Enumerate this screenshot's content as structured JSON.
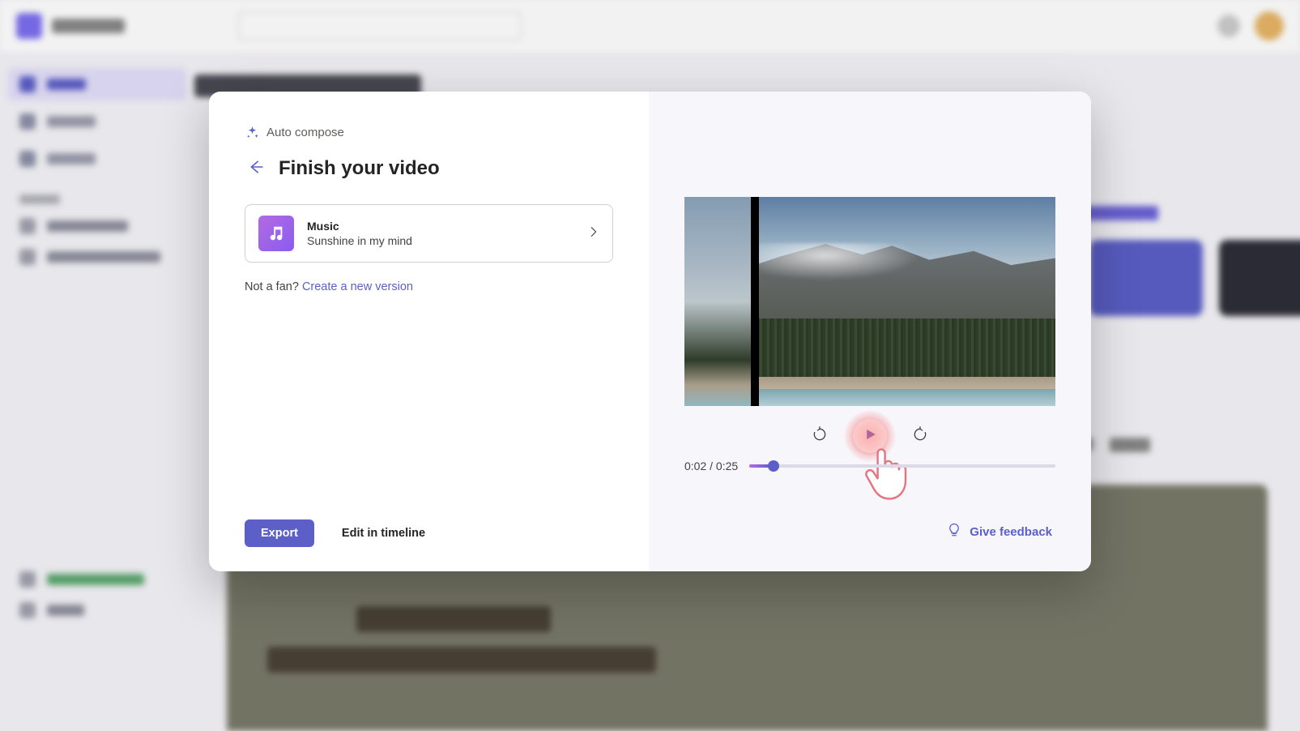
{
  "dialog": {
    "auto_compose_label": "Auto compose",
    "title": "Finish your video",
    "music": {
      "label": "Music",
      "track": "Sunshine in my mind"
    },
    "not_fan_text": "Not a fan? ",
    "create_new_link": "Create a new version",
    "export_label": "Export",
    "edit_timeline_label": "Edit in timeline"
  },
  "player": {
    "current_time": "0:02",
    "total_time": "0:25",
    "time_display": "0:02 / 0:25",
    "progress_pct": 8
  },
  "feedback": {
    "label": "Give feedback"
  },
  "colors": {
    "accent": "#5b5fc7",
    "accent_alt": "#b36ae2"
  }
}
